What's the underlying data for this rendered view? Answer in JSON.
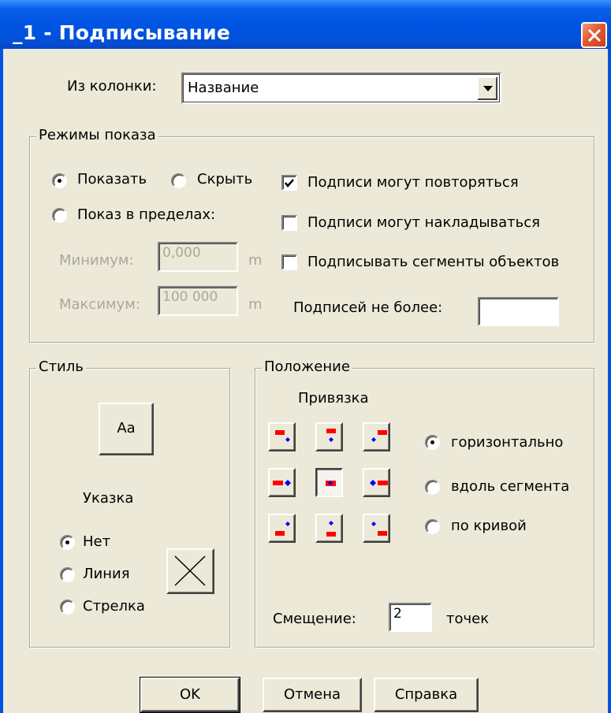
{
  "window": {
    "title": "_1 - Подписывание"
  },
  "source": {
    "label": "Из колонки:",
    "value": "Название"
  },
  "display_modes": {
    "title": "Режимы показа",
    "show_label": "Показать",
    "hide_label": "Скрыть",
    "range_label": "Показ в пределах:",
    "min_label": "Минимум:",
    "min_value": "0,000",
    "max_label": "Максимум:",
    "max_value": "100 000",
    "unit": "m",
    "repeat_label": "Подписи могут повторяться",
    "repeat_checked": true,
    "overlap_label": "Подписи могут накладываться",
    "overlap_checked": false,
    "segments_label": "Подписывать сегменты объектов",
    "segments_checked": false,
    "limit_label": "Подписей не более:",
    "limit_value": ""
  },
  "style": {
    "title": "Стиль",
    "font_button": "Aa",
    "pointer_label": "Указка",
    "pointer_none": "Нет",
    "pointer_line": "Линия",
    "pointer_arrow": "Стрелка"
  },
  "position": {
    "title": "Положение",
    "anchor_label": "Привязка",
    "horizontal": "горизонтально",
    "along_segment": "вдоль сегмента",
    "along_curve": "по кривой",
    "offset_label": "Смещение:",
    "offset_value": "2",
    "offset_unit": "точек"
  },
  "buttons": {
    "ok": "OK",
    "cancel": "Отмена",
    "help": "Справка"
  },
  "colors": {
    "titlebar": "#0054e3",
    "marker_red": "#ff0000",
    "marker_blue": "#0000ff"
  }
}
